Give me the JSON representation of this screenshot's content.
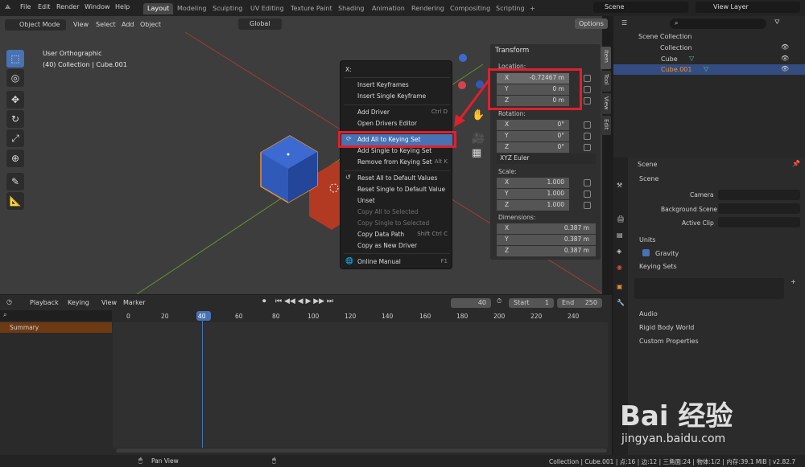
{
  "topbar": {
    "menus": [
      "File",
      "Edit",
      "Render",
      "Window",
      "Help"
    ],
    "workspaces": [
      "Layout",
      "Modeling",
      "Sculpting",
      "UV Editing",
      "Texture Paint",
      "Shading",
      "Animation",
      "Rendering",
      "Compositing",
      "Scripting"
    ],
    "add_tab": "+",
    "scene": "Scene",
    "view_layer": "View Layer"
  },
  "viewport": {
    "mode": "Object Mode",
    "menus": [
      "View",
      "Select",
      "Add",
      "Object"
    ],
    "orientation": "Global",
    "options": "Options",
    "view_name": "User Orthographic",
    "collection_info": "(40) Collection | Cube.001"
  },
  "context_menu": {
    "title": "X:",
    "items": [
      {
        "label": "Insert Keyframes",
        "shortcut": "",
        "disabled": false
      },
      {
        "label": "Insert Single Keyframe",
        "shortcut": "",
        "disabled": false
      },
      {
        "label": "Add Driver",
        "shortcut": "Ctrl D",
        "disabled": false
      },
      {
        "label": "Open Drivers Editor",
        "shortcut": "",
        "disabled": false
      },
      {
        "label": "Add All to Keying Set",
        "shortcut": "",
        "disabled": false
      },
      {
        "label": "Add Single to Keying Set",
        "shortcut": "",
        "disabled": false
      },
      {
        "label": "Remove from Keying Set",
        "shortcut": "Alt K",
        "disabled": false
      },
      {
        "label": "Reset All to Default Values",
        "shortcut": "",
        "disabled": false
      },
      {
        "label": "Reset Single to Default Value",
        "shortcut": "",
        "disabled": false
      },
      {
        "label": "Unset",
        "shortcut": "",
        "disabled": false
      },
      {
        "label": "Copy All to Selected",
        "shortcut": "",
        "disabled": true
      },
      {
        "label": "Copy Single to Selected",
        "shortcut": "",
        "disabled": true
      },
      {
        "label": "Copy Data Path",
        "shortcut": "Shift Ctrl C",
        "disabled": false
      },
      {
        "label": "Copy as New Driver",
        "shortcut": "",
        "disabled": false
      },
      {
        "label": "Online Manual",
        "shortcut": "F1",
        "disabled": false
      }
    ]
  },
  "transform": {
    "title": "Transform",
    "location_label": "Location:",
    "location": [
      {
        "axis": "X",
        "value": "-0.72467 m"
      },
      {
        "axis": "Y",
        "value": "0 m"
      },
      {
        "axis": "Z",
        "value": "0 m"
      }
    ],
    "rotation_label": "Rotation:",
    "rotation": [
      {
        "axis": "X",
        "value": "0°"
      },
      {
        "axis": "Y",
        "value": "0°"
      },
      {
        "axis": "Z",
        "value": "0°"
      }
    ],
    "rotation_mode": "XYZ Euler",
    "scale_label": "Scale:",
    "scale": [
      {
        "axis": "X",
        "value": "1.000"
      },
      {
        "axis": "Y",
        "value": "1.000"
      },
      {
        "axis": "Z",
        "value": "1.000"
      }
    ],
    "dimensions_label": "Dimensions:",
    "dimensions": [
      {
        "axis": "X",
        "value": "0.387 m"
      },
      {
        "axis": "Y",
        "value": "0.387 m"
      },
      {
        "axis": "Z",
        "value": "0.387 m"
      }
    ]
  },
  "side_tabs": [
    "Item",
    "Tool",
    "View",
    "Edit"
  ],
  "outliner": {
    "root": "Scene Collection",
    "collection": "Collection",
    "items": [
      "Cube",
      "Cube.001"
    ]
  },
  "properties": {
    "header": "Scene",
    "section": "Scene",
    "camera_label": "Camera",
    "background_label": "Background Scene",
    "clip_label": "Active Clip",
    "units": "Units",
    "gravity": "Gravity",
    "keying_sets": "Keying Sets",
    "audio": "Audio",
    "rigid_body": "Rigid Body World",
    "custom_props": "Custom Properties"
  },
  "timeline": {
    "menus": [
      "Playback",
      "Keying",
      "View",
      "Marker"
    ],
    "current_frame": "40",
    "start_label": "Start",
    "start": "1",
    "end_label": "End",
    "end": "250",
    "summary": "Summary",
    "frames": [
      "0",
      "20",
      "40",
      "60",
      "80",
      "100",
      "120",
      "140",
      "160",
      "180",
      "200",
      "220",
      "240"
    ]
  },
  "status": {
    "hint": "Pan View",
    "info": "Collection | Cube.001 | 点:16 | 边:12 | 三角面:24 | 物体:1/2 | 内存:39.1 MiB | v2.82.7"
  },
  "watermark": {
    "brand": "Bai 经验",
    "url": "jingyan.baidu.com"
  },
  "colors": {
    "accent": "#4772b3",
    "highlight_box": "#e0202c",
    "cube_blue": "#2f5ab8",
    "cube_red": "#b33a22",
    "orange": "#e7903a"
  }
}
